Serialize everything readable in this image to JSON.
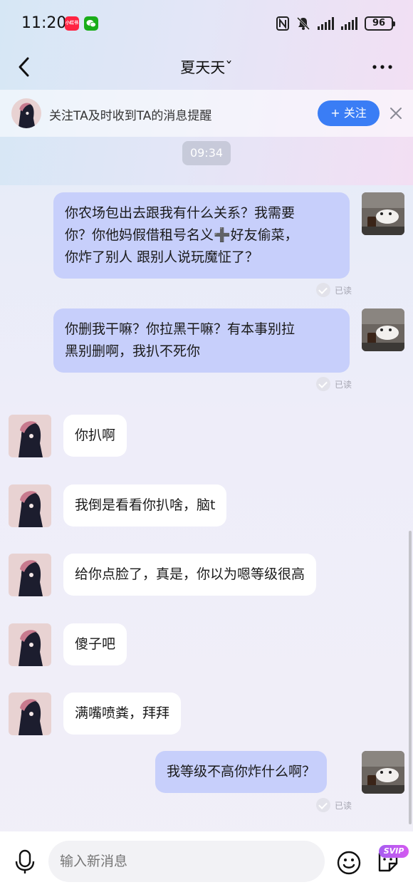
{
  "status_bar": {
    "time": "11:20",
    "app_badge_red": "小红书",
    "battery": "96"
  },
  "nav": {
    "title": "夏天天ˇ"
  },
  "follow_banner": {
    "text": "关注TA及时收到TA的消息提醒",
    "button": "+ 关注"
  },
  "chat": {
    "timestamp": "09:34",
    "read_label": "已读",
    "messages": [
      {
        "from": "me",
        "text_lines": [
          "你农场包出去跟我有什么关系？我需要",
          "你？你他妈假借租号名义➕好友偷菜，",
          "你炸了别人 跟别人说玩魔怔了？"
        ]
      },
      {
        "from": "me",
        "text_lines": [
          "你删我干嘛？你拉黑干嘛？有本事别拉",
          "黑别删啊，我扒不死你"
        ]
      },
      {
        "from": "them",
        "text": "你扒啊"
      },
      {
        "from": "them",
        "text": "我倒是看看你扒啥，脑t"
      },
      {
        "from": "them",
        "text": "给你点脸了，真是，你以为嗯等级很高"
      },
      {
        "from": "them",
        "text": "傻子吧"
      },
      {
        "from": "them",
        "text": "满嘴喷粪，拜拜"
      },
      {
        "from": "me",
        "text": "我等级不高你炸什么啊？"
      }
    ]
  },
  "input_bar": {
    "placeholder": "输入新消息",
    "svip_badge": "SVIP"
  },
  "colors": {
    "my_bubble": "#c7cffb",
    "their_bubble": "#ffffff",
    "follow_button": "#3a7df5"
  }
}
